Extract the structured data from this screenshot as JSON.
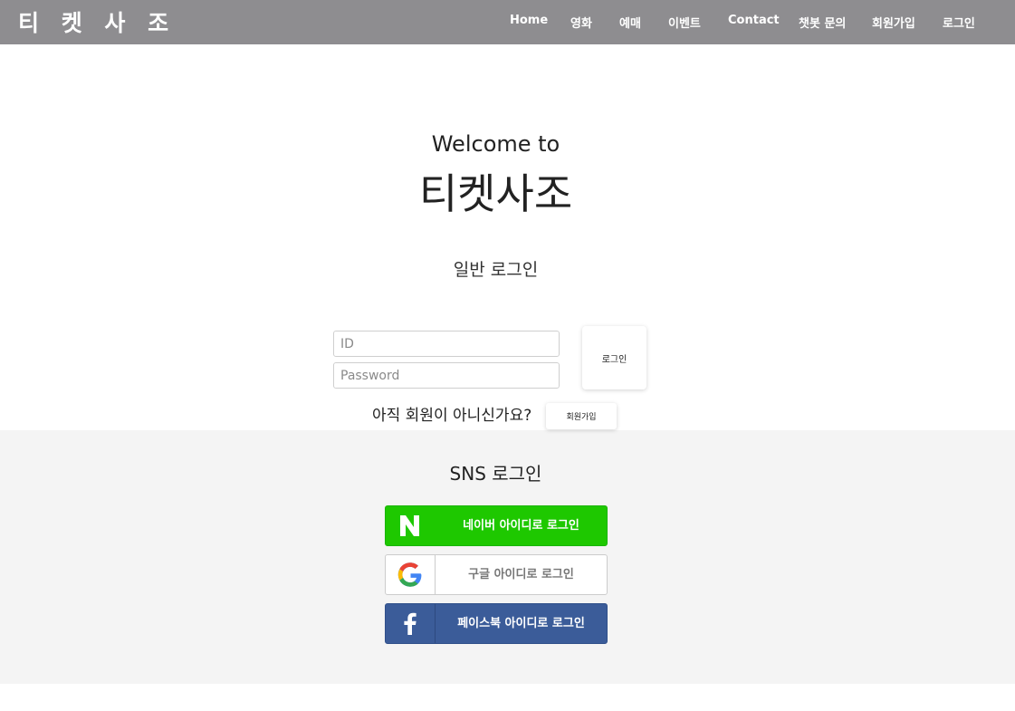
{
  "navbar": {
    "brand": "티 켓 사 조",
    "items": [
      "Home",
      "영화",
      "예매",
      "이벤트",
      "Contact",
      "챗봇 문의",
      "회원가입",
      "로그인"
    ]
  },
  "hero": {
    "welcome": "Welcome to",
    "site_name": "티켓사조"
  },
  "login": {
    "title": "일반 로그인",
    "id_placeholder": "ID",
    "password_placeholder": "Password",
    "login_button": "로그인",
    "not_member_text": "아직 회원이 아니신가요?",
    "signup_button": "회원가입"
  },
  "sns": {
    "title": "SNS 로그인",
    "naver_label": "네이버 아이디로 로그인",
    "google_label": "구글 아이디로 로그인",
    "facebook_label": "페이스북 아이디로 로그인",
    "colors": {
      "naver": "#1ec800",
      "facebook": "#3b5c99",
      "navbar": "#8e8d90"
    }
  }
}
